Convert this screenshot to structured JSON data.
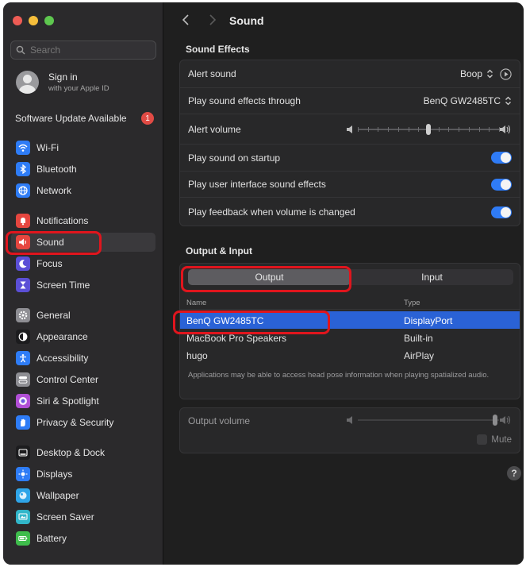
{
  "window": {
    "title": "Sound"
  },
  "sidebar": {
    "search_placeholder": "Search",
    "account": {
      "title": "Sign in",
      "subtitle": "with your Apple ID"
    },
    "update": {
      "label": "Software Update Available",
      "badge": "1"
    },
    "items": [
      {
        "label": "Wi-Fi",
        "icon": "wifi-icon",
        "color": "#2e7cf6"
      },
      {
        "label": "Bluetooth",
        "icon": "bluetooth-icon",
        "color": "#2e7cf6"
      },
      {
        "label": "Network",
        "icon": "globe-icon",
        "color": "#2e7cf6"
      },
      {
        "label": "Notifications",
        "icon": "bell-icon",
        "color": "#e5463f"
      },
      {
        "label": "Sound",
        "icon": "speaker-icon",
        "color": "#e5463f",
        "selected": true
      },
      {
        "label": "Focus",
        "icon": "moon-icon",
        "color": "#5b4fd6"
      },
      {
        "label": "Screen Time",
        "icon": "hourglass-icon",
        "color": "#5b4fd6"
      },
      {
        "label": "General",
        "icon": "gear-icon",
        "color": "#8e8e93"
      },
      {
        "label": "Appearance",
        "icon": "appearance-icon",
        "color": "#1c1c1e"
      },
      {
        "label": "Accessibility",
        "icon": "accessibility-icon",
        "color": "#2e7cf6"
      },
      {
        "label": "Control Center",
        "icon": "control-center-icon",
        "color": "#8e8e93"
      },
      {
        "label": "Siri & Spotlight",
        "icon": "siri-icon",
        "color": "#b14fd6"
      },
      {
        "label": "Privacy & Security",
        "icon": "hand-icon",
        "color": "#2e7cf6"
      },
      {
        "label": "Desktop & Dock",
        "icon": "dock-icon",
        "color": "#1c1c1e"
      },
      {
        "label": "Displays",
        "icon": "sun-icon",
        "color": "#2e7cf6"
      },
      {
        "label": "Wallpaper",
        "icon": "wallpaper-icon",
        "color": "#2fa5e8"
      },
      {
        "label": "Screen Saver",
        "icon": "screen-saver-icon",
        "color": "#31b6c9"
      },
      {
        "label": "Battery",
        "icon": "battery-icon",
        "color": "#3fbd4c"
      }
    ]
  },
  "sound_effects": {
    "title": "Sound Effects",
    "alert_sound": {
      "label": "Alert sound",
      "value": "Boop"
    },
    "play_through": {
      "label": "Play sound effects through",
      "value": "BenQ GW2485TC"
    },
    "alert_volume": {
      "label": "Alert volume",
      "level": 0.5
    },
    "startup": {
      "label": "Play sound on startup",
      "on": true
    },
    "ui_effects": {
      "label": "Play user interface sound effects",
      "on": true
    },
    "feedback": {
      "label": "Play feedback when volume is changed",
      "on": true
    }
  },
  "output_input": {
    "title": "Output & Input",
    "tabs": {
      "output": "Output",
      "input": "Input"
    },
    "columns": {
      "name": "Name",
      "type": "Type"
    },
    "devices": [
      {
        "name": "BenQ GW2485TC",
        "type": "DisplayPort",
        "selected": true
      },
      {
        "name": "MacBook Pro Speakers",
        "type": "Built-in"
      },
      {
        "name": "hugo",
        "type": "AirPlay"
      }
    ],
    "note": "Applications may be able to access head pose information when playing spatialized audio."
  },
  "output_volume": {
    "label": "Output volume",
    "level": 0.97,
    "mute_label": "Mute"
  },
  "help": "?",
  "colors": {
    "accent": "#2f7bf5",
    "selection": "#2a62d6",
    "annotation": "#e0151d"
  }
}
